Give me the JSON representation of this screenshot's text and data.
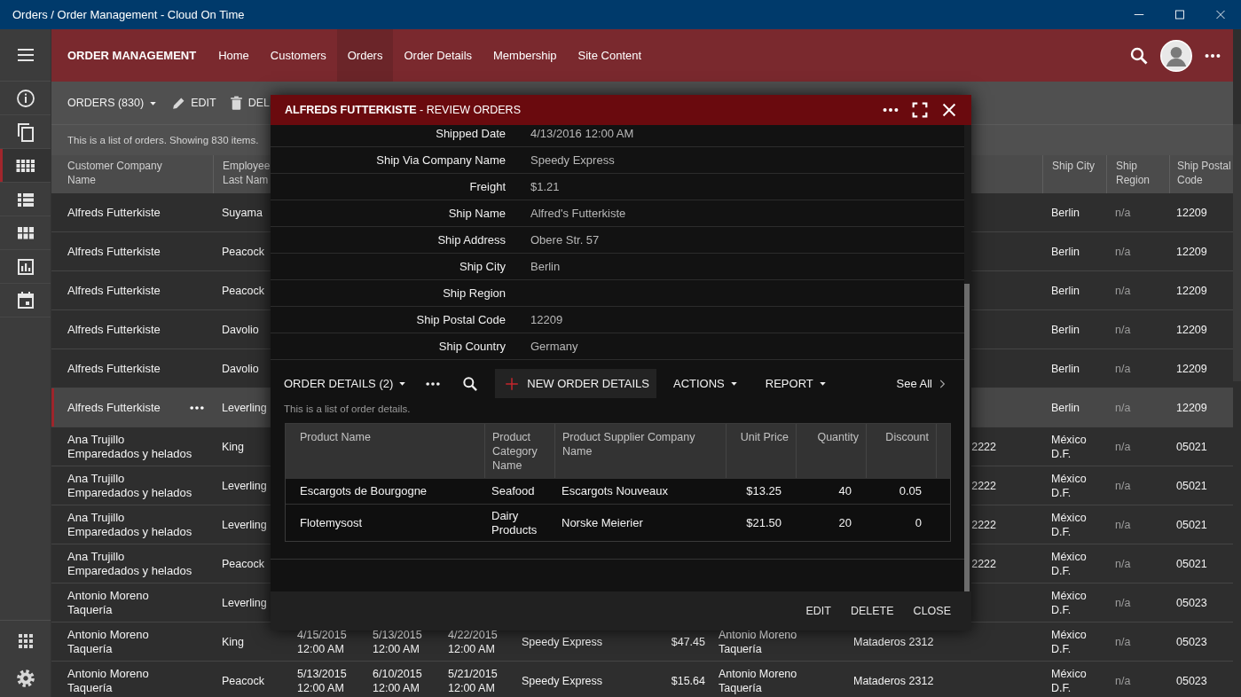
{
  "window": {
    "title": "Orders / Order Management - Cloud On Time",
    "controls": [
      {
        "kind": "minimize"
      },
      {
        "kind": "maximize"
      },
      {
        "kind": "close"
      }
    ]
  },
  "rail": {
    "top": [
      {
        "kind": "menu"
      }
    ],
    "items": [
      {
        "kind": "info",
        "selected": false
      },
      {
        "kind": "copy",
        "selected": false
      },
      {
        "kind": "module",
        "selected": true
      },
      {
        "kind": "list",
        "selected": false
      },
      {
        "kind": "tiles",
        "selected": false
      },
      {
        "kind": "chart",
        "selected": false
      },
      {
        "kind": "calendar",
        "selected": false
      }
    ],
    "bottom": [
      {
        "kind": "apps"
      },
      {
        "kind": "settings"
      }
    ]
  },
  "topbar": {
    "brand": "ORDER MANAGEMENT",
    "nav": [
      {
        "label": "Home",
        "selected": false
      },
      {
        "label": "Customers",
        "selected": false
      },
      {
        "label": "Orders",
        "selected": true
      },
      {
        "label": "Order Details",
        "selected": false
      },
      {
        "label": "Membership",
        "selected": false
      },
      {
        "label": "Site Content",
        "selected": false
      }
    ],
    "actions": [
      {
        "kind": "search"
      },
      {
        "kind": "avatar"
      },
      {
        "kind": "more"
      }
    ]
  },
  "toolbar": {
    "items": [
      {
        "kind": "dropdown",
        "label": "ORDERS (830)"
      },
      {
        "kind": "edit",
        "label": "EDIT"
      },
      {
        "kind": "delete",
        "label": "DEL"
      }
    ]
  },
  "description": "This is a list of orders. Showing 830 items.",
  "grid": {
    "columns": [
      "Customer Company Name",
      "Employee Last Nam",
      null,
      null,
      null,
      null,
      null,
      null,
      null,
      "Ship City",
      "Ship Region",
      "Ship Postal Code"
    ],
    "rows": [
      {
        "selected": false,
        "cells": [
          "Alfreds Futterkiste",
          "Suyama",
          null,
          null,
          null,
          null,
          null,
          null,
          null,
          "Berlin",
          "n/a",
          "12209"
        ]
      },
      {
        "selected": false,
        "cells": [
          "Alfreds Futterkiste",
          "Peacock",
          null,
          null,
          null,
          null,
          null,
          null,
          null,
          "Berlin",
          "n/a",
          "12209"
        ]
      },
      {
        "selected": false,
        "cells": [
          "Alfreds Futterkiste",
          "Peacock",
          null,
          null,
          null,
          null,
          null,
          null,
          null,
          "Berlin",
          "n/a",
          "12209"
        ]
      },
      {
        "selected": false,
        "cells": [
          "Alfreds Futterkiste",
          "Davolio",
          null,
          null,
          null,
          null,
          null,
          null,
          null,
          "Berlin",
          "n/a",
          "12209"
        ]
      },
      {
        "selected": false,
        "cells": [
          "Alfreds Futterkiste",
          "Davolio",
          null,
          null,
          null,
          null,
          null,
          null,
          null,
          "Berlin",
          "n/a",
          "12209"
        ]
      },
      {
        "selected": true,
        "cells": [
          "Alfreds Futterkiste",
          "Leverling",
          null,
          null,
          null,
          null,
          null,
          null,
          null,
          "Berlin",
          "n/a",
          "12209"
        ]
      },
      {
        "selected": false,
        "cells": [
          "Ana Trujillo Emparedados y helados",
          "King",
          null,
          null,
          null,
          null,
          null,
          null,
          {
            "text": "2222",
            "cut": true
          },
          "México D.F.",
          "n/a",
          "05021"
        ]
      },
      {
        "selected": false,
        "cells": [
          "Ana Trujillo Emparedados y helados",
          "Leverling",
          null,
          null,
          null,
          null,
          null,
          null,
          {
            "text": "2222",
            "cut": true
          },
          "México D.F.",
          "n/a",
          "05021"
        ]
      },
      {
        "selected": false,
        "cells": [
          "Ana Trujillo Emparedados y helados",
          "Leverling",
          null,
          null,
          null,
          null,
          null,
          null,
          {
            "text": "2222",
            "cut": true
          },
          "México D.F.",
          "n/a",
          "05021"
        ]
      },
      {
        "selected": false,
        "cells": [
          "Ana Trujillo Emparedados y helados",
          "Peacock",
          null,
          null,
          null,
          null,
          null,
          null,
          {
            "text": "2222",
            "cut": true
          },
          "México D.F.",
          "n/a",
          "05021"
        ]
      },
      {
        "selected": false,
        "cells": [
          "Antonio Moreno Taquería",
          "Leverling",
          null,
          null,
          null,
          null,
          null,
          null,
          null,
          "México D.F.",
          "n/a",
          "05023"
        ]
      },
      {
        "selected": false,
        "cells": [
          "Antonio Moreno Taquería",
          "King",
          "4/15/2015 12:00 AM",
          "5/13/2015 12:00 AM",
          "4/22/2015 12:00 AM",
          "Speedy Express",
          "$47.45",
          "Antonio Moreno Taquería",
          "Mataderos 2312",
          "México D.F.",
          "n/a",
          "05023"
        ]
      },
      {
        "selected": false,
        "cells": [
          "Antonio Moreno Taquería",
          "Peacock",
          "5/13/2015 12:00 AM",
          "6/10/2015 12:00 AM",
          "5/21/2015 12:00 AM",
          "Speedy Express",
          "$15.64",
          "Antonio Moreno Taquería",
          "Mataderos 2312",
          "México D.F.",
          "n/a",
          "05023"
        ]
      }
    ]
  },
  "modal": {
    "title": "**ALFREDS FUTTERKISTE** - REVIEW ORDERS",
    "actions": [
      {
        "kind": "more"
      },
      {
        "kind": "fullscreen"
      },
      {
        "kind": "close"
      }
    ],
    "fields": [
      {
        "label": "Shipped Date",
        "value": "4/13/2016 12:00 AM"
      },
      {
        "label": "Ship Via Company Name",
        "value": "Speedy Express"
      },
      {
        "label": "Freight",
        "value": "$1.21"
      },
      {
        "label": "Ship Name",
        "value": "Alfred's Futterkiste"
      },
      {
        "label": "Ship Address",
        "value": "Obere Str. 57"
      },
      {
        "label": "Ship City",
        "value": "Berlin"
      },
      {
        "label": "Ship Region"
      },
      {
        "label": "Ship Postal Code",
        "value": "12209"
      },
      {
        "label": "Ship Country",
        "value": "Germany"
      }
    ],
    "details": {
      "toolbar": [
        {
          "kind": "dropdown",
          "label": "ORDER DETAILS (2)"
        },
        {
          "kind": "more"
        },
        {
          "kind": "search"
        },
        {
          "kind": "new",
          "label": "NEW ORDER DETAILS"
        },
        {
          "kind": "dropdown",
          "label": "ACTIONS"
        },
        {
          "kind": "dropdown",
          "label": "REPORT"
        },
        {
          "kind": "see_all",
          "label": "See All"
        }
      ],
      "description": "This is a list of order details.",
      "columns": [
        "Product Name",
        "Product Category Name",
        "Product Supplier Company Name",
        "Unit Price",
        "Quantity",
        "Discount"
      ],
      "rows": [
        [
          "Escargots de Bourgogne",
          "Seafood",
          "Escargots Nouveaux",
          "$13.25",
          "40",
          "0.05"
        ],
        [
          "Flotemysost",
          "Dairy Products",
          "Norske Meierier",
          "$21.50",
          "20",
          "0"
        ]
      ]
    },
    "buttons": [
      "EDIT",
      "DELETE",
      "CLOSE"
    ]
  }
}
